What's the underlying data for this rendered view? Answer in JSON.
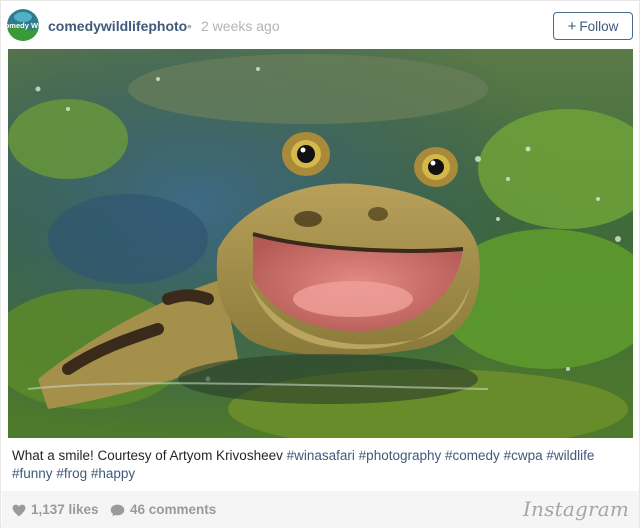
{
  "header": {
    "username": "comedywildlifephoto",
    "separator": "•",
    "timestamp": "2 weeks ago",
    "avatar_text": "Comedy Wild",
    "follow_label": "Follow",
    "follow_icon": "plus-icon"
  },
  "photo": {
    "subject": "frog-in-pond-photo"
  },
  "caption": {
    "text": "What a smile! Courtesy of Artyom Krivosheev",
    "hashtags": [
      "#winasafari",
      "#photography",
      "#comedy",
      "#cwpa",
      "#wildlife",
      "#funny",
      "#frog",
      "#happy"
    ]
  },
  "footer": {
    "likes": "1,137 likes",
    "comments": "46 comments",
    "brand": "Instagram",
    "like_icon": "heart-icon",
    "comment_icon": "speech-bubble-icon"
  },
  "colors": {
    "link": "#3f5a7a",
    "muted": "#b3b3b3",
    "footer_bg": "#f5f5f5",
    "stat_text": "#9a9a9a"
  }
}
